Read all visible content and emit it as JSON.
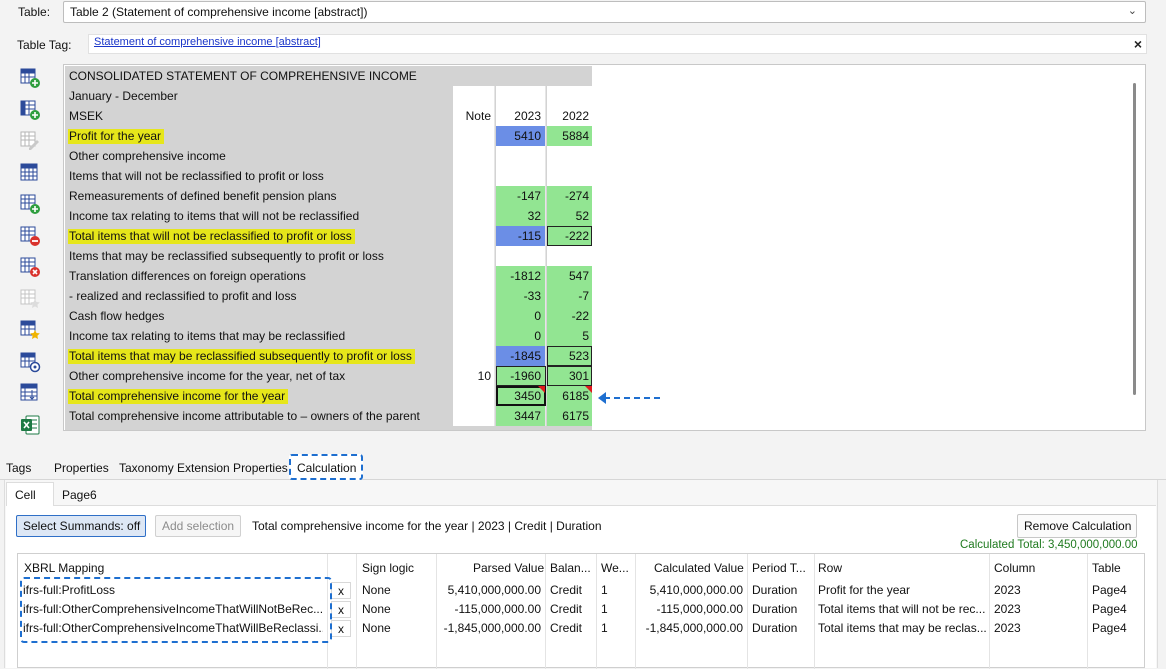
{
  "header": {
    "table_label": "Table:",
    "table_value": "Table 2 (Statement of comprehensive income [abstract])",
    "table_tag_label": "Table Tag:",
    "table_tag_link": "Statement of comprehensive income [abstract]",
    "close_glyph": "×",
    "chevron_glyph": "⌄"
  },
  "toolbar": {
    "icons": [
      "table-add-row-icon",
      "table-add-column-icon",
      "table-edit-icon",
      "table-grid-icon",
      "table-insert-icon",
      "table-remove-icon",
      "table-delete-icon",
      "table-star-disabled-icon",
      "table-star-icon",
      "table-settings-icon",
      "table-sort-icon",
      "excel-icon"
    ]
  },
  "grid": {
    "rows": [
      {
        "label": "CONSOLIDATED STATEMENT OF COMPREHENSIVE INCOME",
        "note": "",
        "y2023": "",
        "y2022": "",
        "hl": false,
        "gray_only": true
      },
      {
        "label": "January - December",
        "note": "",
        "y2023": "",
        "y2022": "",
        "hl": false
      },
      {
        "label": "MSEK",
        "note": "Note",
        "y2023": "2023",
        "y2022": "2022",
        "hl": false
      },
      {
        "label": "Profit for the year",
        "note": "",
        "y2023": "5410",
        "y2022": "5884",
        "hl": true,
        "c23": "blue",
        "c22": "green"
      },
      {
        "label": "Other comprehensive income",
        "note": "",
        "y2023": "",
        "y2022": "",
        "hl": false
      },
      {
        "label": "Items that will not be reclassified to profit or loss",
        "note": "",
        "y2023": "",
        "y2022": "",
        "hl": false
      },
      {
        "label": "Remeasurements of defined benefit pension plans",
        "note": "",
        "y2023": "-147",
        "y2022": "-274",
        "hl": false,
        "c23": "green",
        "c22": "green"
      },
      {
        "label": "Income tax relating to items that will not be reclassified",
        "note": "",
        "y2023": "32",
        "y2022": "52",
        "hl": false,
        "c23": "green",
        "c22": "green"
      },
      {
        "label": "Total items that will not be reclassified to profit or loss",
        "note": "",
        "y2023": "-115",
        "y2022": "-222",
        "hl": true,
        "c23": "blue",
        "c22": "green-outlined"
      },
      {
        "label": "Items that may be reclassified subsequently to profit or loss",
        "note": "",
        "y2023": "",
        "y2022": "",
        "hl": false
      },
      {
        "label": "Translation differences on foreign operations",
        "note": "",
        "y2023": "-1812",
        "y2022": "547",
        "hl": false,
        "c23": "green",
        "c22": "green"
      },
      {
        "label": "- realized and reclassified to profit and loss",
        "note": "",
        "y2023": "-33",
        "y2022": "-7",
        "hl": false,
        "c23": "green",
        "c22": "green"
      },
      {
        "label": "Cash flow hedges",
        "note": "",
        "y2023": "0",
        "y2022": "-22",
        "hl": false,
        "c23": "green",
        "c22": "green"
      },
      {
        "label": "Income tax relating to items that may be reclassified",
        "note": "",
        "y2023": "0",
        "y2022": "5",
        "hl": false,
        "c23": "green",
        "c22": "green"
      },
      {
        "label": "Total items that may be reclassified subsequently to profit or loss",
        "note": "",
        "y2023": "-1845",
        "y2022": "523",
        "hl": true,
        "c23": "blue",
        "c22": "green-outlined"
      },
      {
        "label": "Other comprehensive income for the year, net of tax",
        "note": "10",
        "y2023": "-1960",
        "y2022": "301",
        "hl": false,
        "c23": "green-outlined",
        "c22": "green-outlined"
      },
      {
        "label": "Total comprehensive income for the year",
        "note": "",
        "y2023": "3450",
        "y2022": "6185",
        "hl": true,
        "c23": "green-selected",
        "c22": "green-flag"
      },
      {
        "label": "Total comprehensive income attributable to – owners of the parent",
        "note": "",
        "y2023": "3447",
        "y2022": "6175",
        "hl": false,
        "c23": "green",
        "c22": "green"
      }
    ]
  },
  "tabs": {
    "items": [
      "Tags",
      "Properties",
      "Taxonomy Extension Properties",
      "Calculation"
    ],
    "active": "Calculation",
    "subtabs": [
      "Cell",
      "Page6"
    ]
  },
  "calculation": {
    "select_summands": "Select Summands: off",
    "add_selection": "Add selection",
    "description": "Total comprehensive income for the year | 2023 | Credit | Duration",
    "remove_button": "Remove Calculation",
    "calculated_total": "Calculated Total: 3,450,000,000.00",
    "columns": [
      "XBRL Mapping",
      "Sign logic",
      "Parsed Value",
      "Balan...",
      "We...",
      "Calculated Value",
      "Period T...",
      "Row",
      "Column",
      "Table"
    ],
    "rows": [
      {
        "mapping": "ifrs-full:ProfitLoss",
        "x": "x",
        "sign": "None",
        "parsed": "5,410,000,000.00",
        "balance": "Credit",
        "weight": "1",
        "calculated": "5,410,000,000.00",
        "period": "Duration",
        "row": "Profit for the year",
        "column": "2023",
        "table": "Page4"
      },
      {
        "mapping": "ifrs-full:OtherComprehensiveIncomeThatWillNotBeRec...",
        "x": "x",
        "sign": "None",
        "parsed": "-115,000,000.00",
        "balance": "Credit",
        "weight": "1",
        "calculated": "-115,000,000.00",
        "period": "Duration",
        "row": "Total items that will not be rec...",
        "column": "2023",
        "table": "Page4"
      },
      {
        "mapping": "ifrs-full:OtherComprehensiveIncomeThatWillBeReclassi...",
        "x": "x",
        "sign": "None",
        "parsed": "-1,845,000,000.00",
        "balance": "Credit",
        "weight": "1",
        "calculated": "-1,845,000,000.00",
        "period": "Duration",
        "row": "Total items that may be reclas...",
        "column": "2023",
        "table": "Page4"
      }
    ]
  },
  "colors": {
    "highlight": "#e6e61a",
    "green": "#92e592",
    "blue": "#6b8ee6",
    "accent": "#1e6fd0",
    "total_text": "#1f7a1f"
  }
}
